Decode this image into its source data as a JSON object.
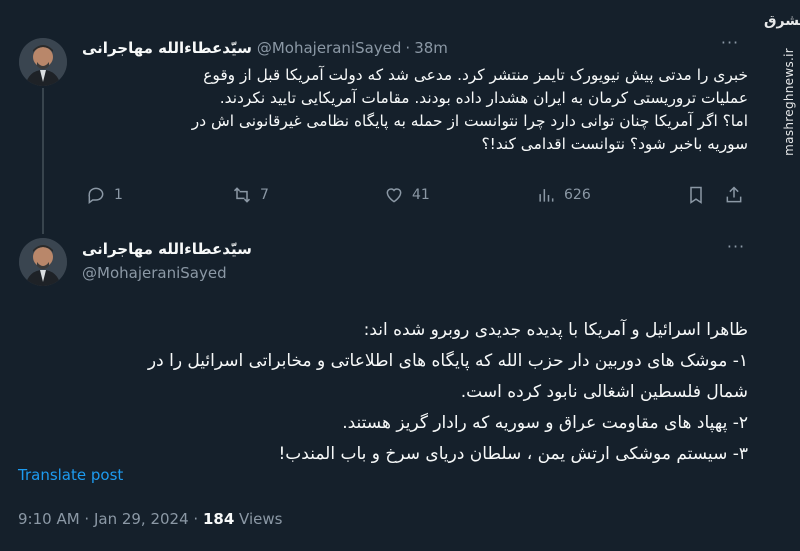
{
  "watermark": {
    "logo": "مشرق",
    "site": "mashreghnews.ir"
  },
  "tweet1": {
    "author": "سیّدعطاءالله مهاجرانی",
    "handle": "@MohajeraniSayed",
    "separator": "·",
    "time": "38m",
    "lines": [
      "خبری را مدتی پیش نیویورک تایمز منتشر کرد. مدعی شد که دولت آمریکا قبل از وقوع",
      "عملیات تروریستی کرمان به ایران هشدار داده بودند. مقامات آمریکایی تایید نکردند.",
      "اما؟ اگر آمریکا چنان توانی دارد چرا نتوانست از حمله به پایگاه نظامی غیرقانونی اش در",
      "سوریه باخبر شود؟ نتوانست اقدامی کند!؟"
    ],
    "replies": "1",
    "reposts": "7",
    "likes": "41",
    "views": "626",
    "more": "···"
  },
  "tweet2": {
    "author": "سیّدعطاءالله مهاجرانی",
    "handle": "@MohajeraniSayed",
    "more": "···",
    "lines": [
      "ظاهرا اسرائیل و آمریکا با پدیده جدیدی روبرو شده اند:",
      "۱- موشک های دوربین دار حزب الله که پایگاه های اطلاعاتی و مخابراتی اسرائیل را در",
      "شمال فلسطین اشغالی نابود کرده است.",
      "۲- پهپاد های مقاومت عراق و سوریه که رادار گریز هستند.",
      "۳- سیستم موشکی ارتش یمن ، سلطان دریای سرخ و باب المندب!"
    ],
    "translate": "Translate post",
    "timestamp": "9:10 AM · Jan 29, 2024 · ",
    "views_count": "184",
    "views_label": " Views"
  },
  "icons": {
    "reply": "reply-icon",
    "repost": "repost-icon",
    "like": "heart-icon",
    "views": "views-icon",
    "bookmark": "bookmark-icon",
    "share": "share-icon"
  },
  "colors": {
    "background": "#15202b",
    "text": "#f7f9f9",
    "muted": "#8b98a5",
    "link": "#1d9bf0"
  }
}
